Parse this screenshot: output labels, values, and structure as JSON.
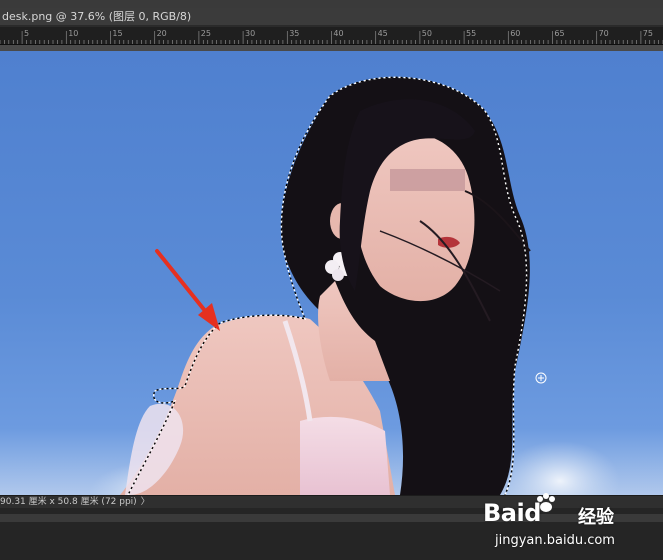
{
  "document": {
    "tab_title": "desk.png @ 37.6% (图层 0, RGB/8)"
  },
  "ruler": {
    "labels": [
      "5",
      "10",
      "15",
      "20",
      "25",
      "30",
      "35",
      "40",
      "45",
      "50",
      "55",
      "60",
      "65",
      "70",
      "75"
    ]
  },
  "canvas": {
    "tool_cursor": "crosshair-cursor-icon",
    "selection": "marching-ants-selection",
    "annotation": "red-arrow-icon"
  },
  "status": {
    "doc_size": "90.31 厘米 x 50.8 厘米 (72 ppi)",
    "arrow": "〉"
  },
  "watermark": {
    "brand_latin": "Baid",
    "brand_cn": "经验",
    "url": "jingyan.baidu.com"
  },
  "colors": {
    "sky": "#5a8bd6",
    "ui_dark": "#2b2b2b",
    "arrow_red": "#e53020"
  }
}
